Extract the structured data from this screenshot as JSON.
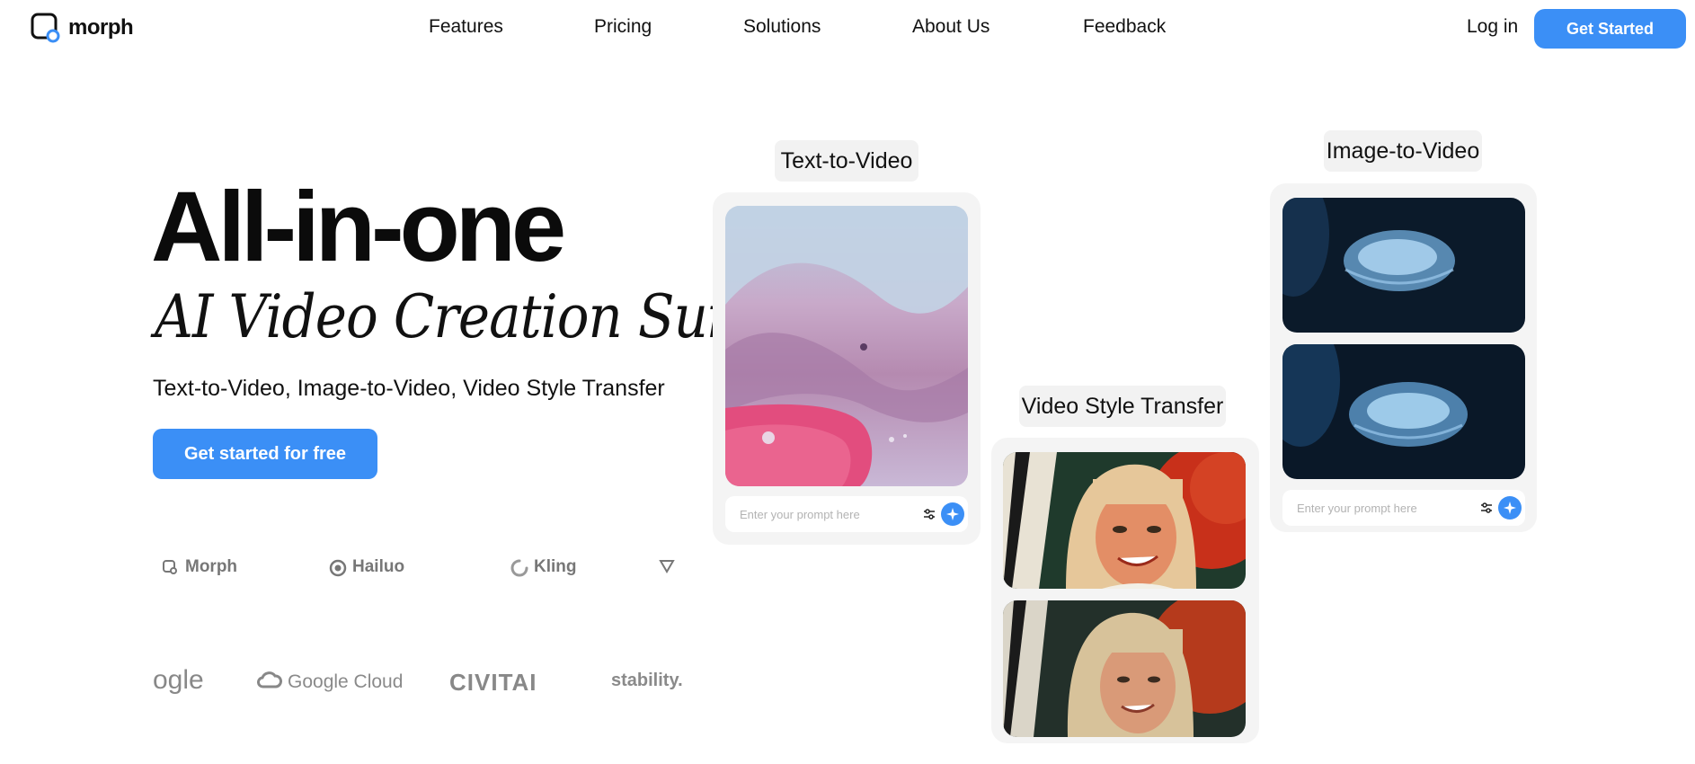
{
  "brand": {
    "name": "morph",
    "accent": "#3b8ff6"
  },
  "nav": {
    "links": [
      "Features",
      "Pricing",
      "Solutions",
      "About Us",
      "Feedback"
    ],
    "login": "Log in",
    "get_started": "Get Started"
  },
  "hero": {
    "title": "All-in-one",
    "script": "AI Video Creation Suite",
    "subtitle": "Text-to-Video, Image-to-Video, Video Style Transfer",
    "cta": "Get started for free"
  },
  "partners_row1": [
    {
      "name": "Morph",
      "icon": "morph-logo-icon"
    },
    {
      "name": "Hailuo",
      "icon": "hailuo-logo-icon"
    },
    {
      "name": "Kling",
      "icon": "kling-logo-icon"
    },
    {
      "name": "",
      "icon": "partner-logo-icon"
    }
  ],
  "partners_row2": [
    "ogle",
    "Google Cloud",
    "CIVITAI",
    "stability."
  ],
  "cards": {
    "text_to_video": {
      "label": "Text-to-Video",
      "placeholder": "Enter your prompt here"
    },
    "style_transfer": {
      "label": "Video Style Transfer"
    },
    "image_to_video": {
      "label": "Image-to-Video",
      "placeholder": "Enter your prompt here"
    }
  }
}
